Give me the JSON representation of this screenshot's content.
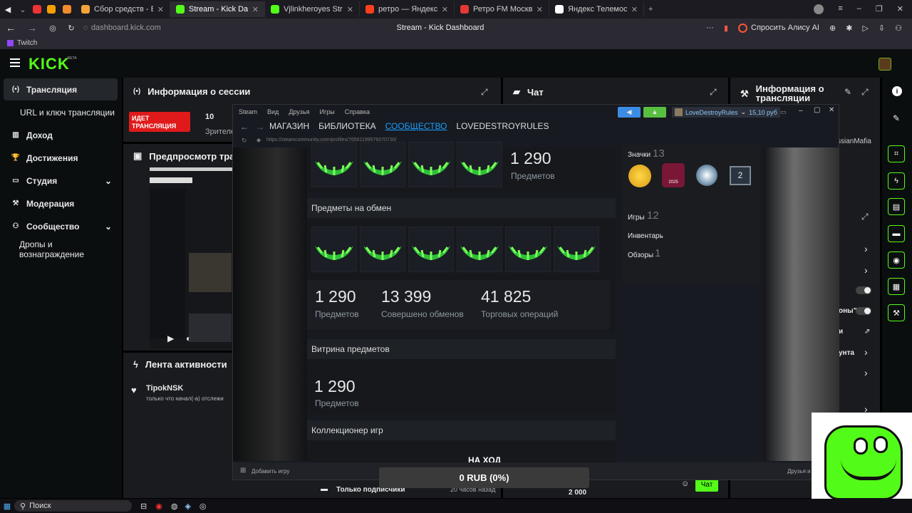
{
  "browser": {
    "tabs": [
      {
        "label": "Сбор средств - Виджеты",
        "color": "#f4a338",
        "glyph": "D"
      },
      {
        "label": "Stream - Kick Dashboard",
        "color": "#53fc18",
        "glyph": "K",
        "active": true
      },
      {
        "label": "Vjlinkheroyes Stream - We",
        "color": "#53fc18",
        "glyph": "K"
      },
      {
        "label": "ретро — Яндекс: нашлось",
        "color": "#fc3f1d",
        "glyph": "Я"
      },
      {
        "label": "Ретро FM Москва -",
        "color": "#e53935",
        "glyph": "R"
      },
      {
        "label": "Яндекс Телемост — бесп",
        "color": "#ffffff",
        "glyph": "Т"
      }
    ],
    "url": "dashboard.kick.com",
    "page_title": "Stream - Kick Dashboard",
    "alice_label": "Спросить Алису AI",
    "bookmark": "Twitch"
  },
  "kick": {
    "logo": "KICK",
    "beta": "BETA",
    "nav": [
      {
        "label": "Трансляция",
        "icon": "broadcast-icon",
        "active": true
      },
      {
        "label": "URL и ключ трансляции",
        "icon": "dot-icon"
      },
      {
        "label": "Доход",
        "icon": "chart-icon"
      },
      {
        "label": "Достижения",
        "icon": "trophy-icon"
      },
      {
        "label": "Студия",
        "icon": "studio-icon",
        "chevron": true
      },
      {
        "label": "Модерация",
        "icon": "wrench-icon"
      },
      {
        "label": "Сообщество",
        "icon": "people-icon",
        "chevron": true
      },
      {
        "label": "Дропы и вознаграждение",
        "icon": ""
      }
    ],
    "session": {
      "title": "Информация о сессии",
      "live_badge": "ИДЕТ ТРАНСЛЯЦИЯ",
      "viewers": "10",
      "viewers_label": "Зрителе"
    },
    "chat": {
      "title": "Чат",
      "send": "Чат",
      "username": "ssianMafia"
    },
    "stream_info": {
      "title": "Информация о трансляции"
    },
    "preview": {
      "title": "Предпросмотр тра"
    },
    "activity": {
      "title": "Лента активности",
      "user": "TipokNSK",
      "text": "только что начал(-а) отслежи"
    },
    "right_items": [
      "оны\"",
      "и",
      "унта"
    ],
    "bottom": {
      "label": "Только подписчики",
      "time": "20 часов назад",
      "amount": "2 000"
    },
    "goal": {
      "title": "НА ХОД",
      "value": "0 RUB (0%)"
    }
  },
  "steam": {
    "menu": [
      "Steam",
      "Вид",
      "Друзья",
      "Игры",
      "Справка"
    ],
    "nav": [
      "МАГАЗИН",
      "БИБЛИОТЕКА",
      "СООБЩЕСТВО",
      "LOVEDESTROYRULES"
    ],
    "active_nav": 2,
    "account": "LoveDestroyRules",
    "balance": "15,10 руб",
    "url": "https://steamcommunity.com/profiles/76561199576070730/",
    "top_count": "1 290",
    "top_label": "Предметов",
    "trade": {
      "title": "Предметы на обмен",
      "stats": [
        {
          "value": "1 290",
          "label": "Предметов"
        },
        {
          "value": "13 399",
          "label": "Совершено обменов"
        },
        {
          "value": "41 825",
          "label": "Торговых операций"
        }
      ]
    },
    "showcase": {
      "title": "Витрина предметов",
      "value": "1 290",
      "label": "Предметов"
    },
    "collector": {
      "title": "Коллекционер игр"
    },
    "side": {
      "badges_label": "Значки",
      "badges_count": "13",
      "games_label": "Игры",
      "games_count": "12",
      "inventory": "Инвентарь",
      "reviews_label": "Обзоры",
      "reviews_count": "1",
      "badge_level": "2",
      "badge_year": "2025"
    },
    "footer_left": "Добавить игру",
    "footer_right": "Друзья и"
  },
  "taskbar": {
    "search": "Поиск"
  }
}
